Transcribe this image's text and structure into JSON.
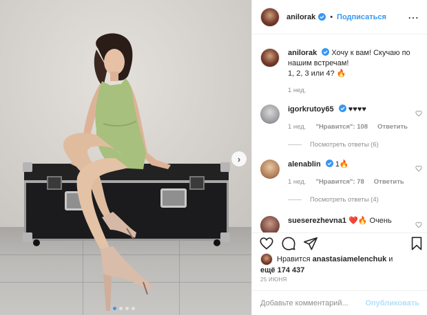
{
  "post": {
    "author": "anilorak",
    "follow_label": "Подписаться",
    "bullet": "•",
    "more_icon": "ellipsis-icon",
    "caption": {
      "username": "anilorak",
      "line1": "Хочу к вам! Скучаю по",
      "line2": "нашим встречам!",
      "line3": "1, 2, 3 или 4? 🔥",
      "time": "1 нед."
    },
    "comments": [
      {
        "username": "igorkrutoy65",
        "text": "♥♥♥♥",
        "time": "1 нед.",
        "likes": "\"Нравится\": 108",
        "reply_label": "Ответить",
        "view_replies": "Посмотреть ответы (6)"
      },
      {
        "username": "alenablin",
        "text": "1🔥",
        "time": "1 нед.",
        "likes": "\"Нравится\": 78",
        "reply_label": "Ответить",
        "view_replies": "Посмотреть ответы (4)"
      },
      {
        "username": "sueserezhevna1",
        "text": "❤️🔥 Очень"
      }
    ],
    "likes_line1_prefix": "Нравится",
    "likes_line1_user": "anastasiamelenchuk",
    "likes_line1_suffix": "и",
    "likes_line2_prefix": "ещё",
    "likes_line2_count": "174 437",
    "date": "25 ИЮНЯ",
    "comment_placeholder": "Добавьте комментарий...",
    "publish_label": "Опубликовать",
    "carousel_next": "›"
  },
  "colors": {
    "accent": "#3897f0",
    "publish_disabled": "#b2dffc",
    "muted": "#8e8e8e",
    "dress": "#a7c07d"
  }
}
